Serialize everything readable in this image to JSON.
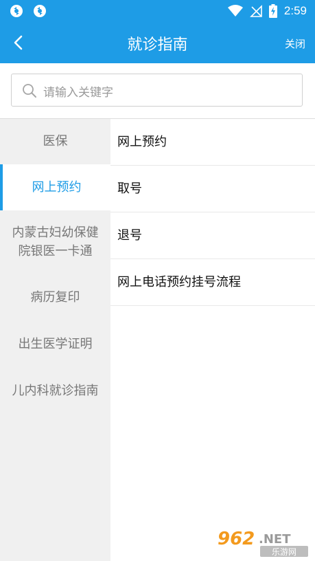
{
  "status": {
    "time": "2:59"
  },
  "header": {
    "title": "就诊指南",
    "close_label": "关闭"
  },
  "search": {
    "placeholder": "请输入关键字"
  },
  "sidebar": {
    "items": [
      {
        "label": "医保"
      },
      {
        "label": "网上预约"
      },
      {
        "label": "内蒙古妇幼保健院银医一卡通"
      },
      {
        "label": "病历复印"
      },
      {
        "label": "出生医学证明"
      },
      {
        "label": "儿内科就诊指南"
      }
    ],
    "active_index": 1
  },
  "list": {
    "items": [
      {
        "label": "网上预约"
      },
      {
        "label": "取号"
      },
      {
        "label": "退号"
      },
      {
        "label": "网上电话预约挂号流程"
      }
    ]
  },
  "watermark": {
    "brand": "962.NET",
    "subtitle": "乐游网"
  },
  "colors": {
    "accent": "#1e9ce6"
  }
}
